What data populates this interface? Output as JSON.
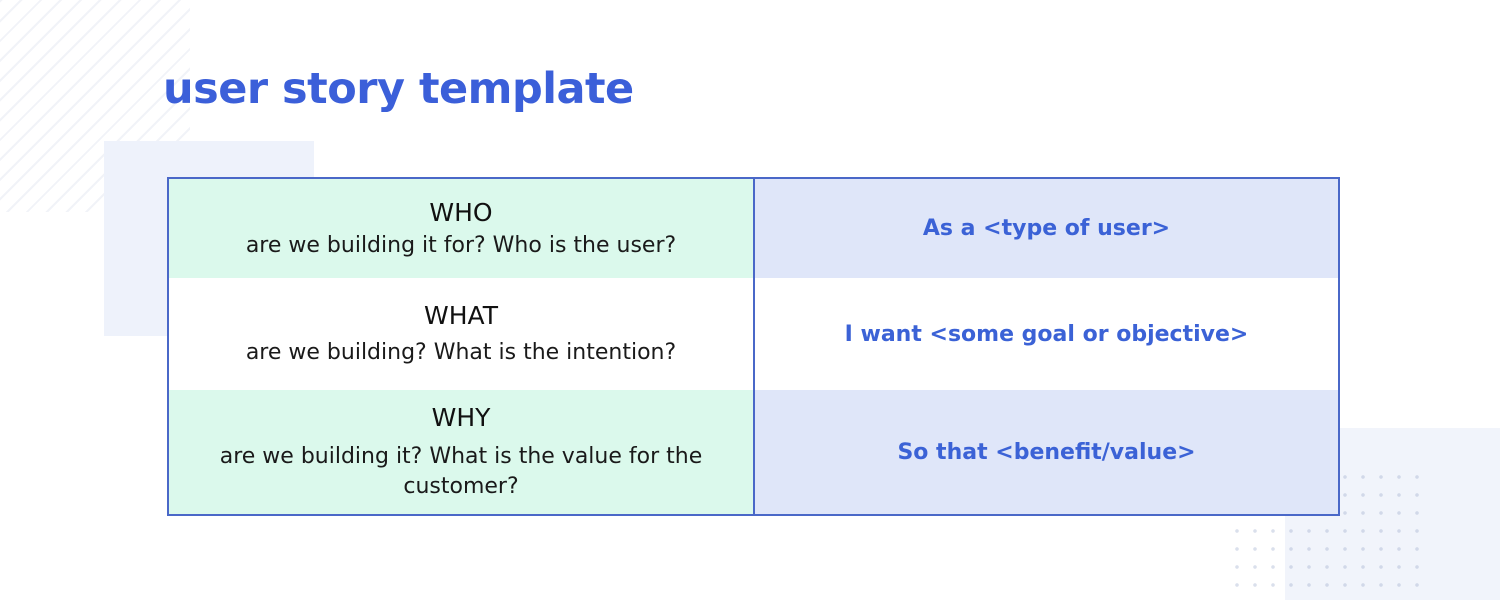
{
  "title": "user story template",
  "rows": [
    {
      "head": "WHO",
      "sub": "are we building it for? Who is the user?",
      "answer": "As a <type of user>"
    },
    {
      "head": "WHAT",
      "sub": "are we building? What is the intention?",
      "answer": "I want <some goal or objective>"
    },
    {
      "head": "WHY",
      "sub": "are we building it? What is the value for the customer?",
      "answer": "So that <benefit/value>"
    }
  ],
  "colors": {
    "accent": "#3b5fd9",
    "border": "#4a68c8",
    "green_cell": "#dbf9ec",
    "blue_cell": "#dfe6f9"
  }
}
